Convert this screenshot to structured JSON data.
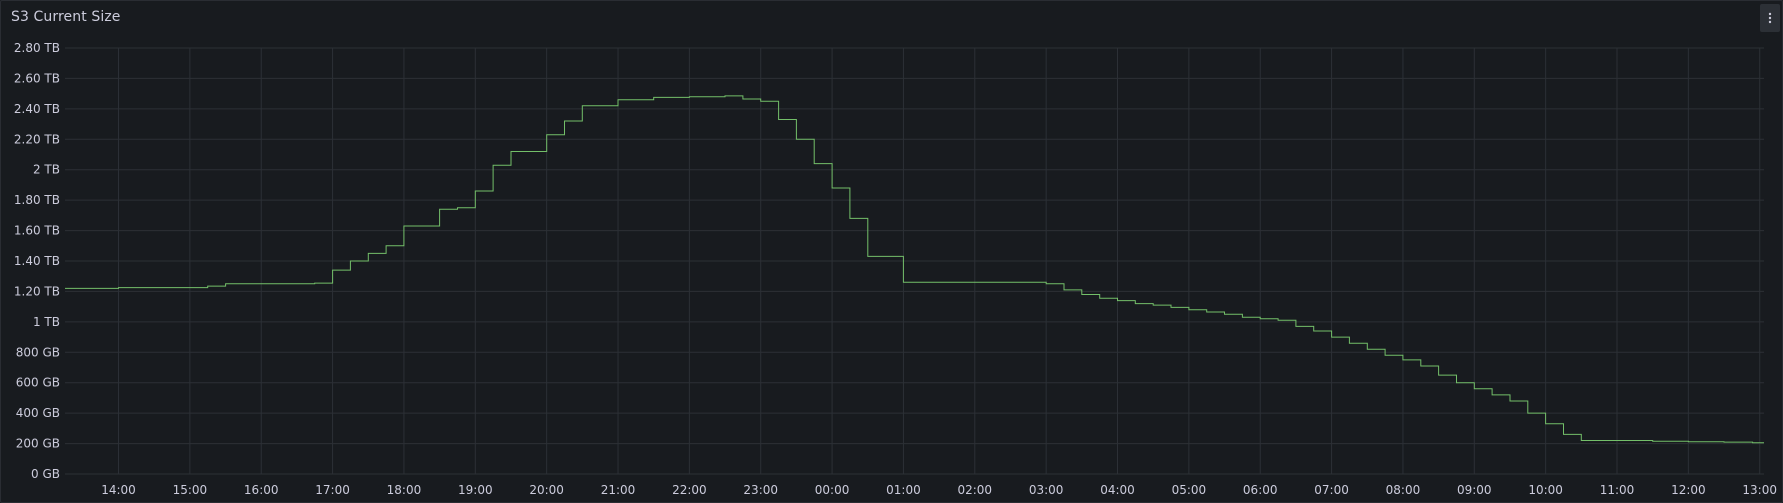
{
  "panel": {
    "title": "S3 Current Size",
    "menu_icon": "kebab-menu-icon"
  },
  "colors": {
    "background": "#181b1f",
    "grid": "#2c3036",
    "series": "#73bf69",
    "text": "#ccccdc"
  },
  "chart_data": {
    "type": "line",
    "interpolation": "step-after",
    "title": "S3 Current Size",
    "xlabel": "",
    "ylabel": "",
    "grid": true,
    "legend": "none",
    "y_unit": "GB",
    "ylim": [
      0,
      2800
    ],
    "yticks": [
      {
        "value": 0,
        "label": "0 GB"
      },
      {
        "value": 200,
        "label": "200 GB"
      },
      {
        "value": 400,
        "label": "400 GB"
      },
      {
        "value": 600,
        "label": "600 GB"
      },
      {
        "value": 800,
        "label": "800 GB"
      },
      {
        "value": 1000,
        "label": "1 TB"
      },
      {
        "value": 1200,
        "label": "1.20 TB"
      },
      {
        "value": 1400,
        "label": "1.40 TB"
      },
      {
        "value": 1600,
        "label": "1.60 TB"
      },
      {
        "value": 1800,
        "label": "1.80 TB"
      },
      {
        "value": 2000,
        "label": "2 TB"
      },
      {
        "value": 2200,
        "label": "2.20 TB"
      },
      {
        "value": 2400,
        "label": "2.40 TB"
      },
      {
        "value": 2600,
        "label": "2.60 TB"
      },
      {
        "value": 2800,
        "label": "2.80 TB"
      }
    ],
    "x_unit": "hours",
    "xlim": [
      13.25,
      37.06
    ],
    "xticks": [
      {
        "value": 14,
        "label": "14:00"
      },
      {
        "value": 15,
        "label": "15:00"
      },
      {
        "value": 16,
        "label": "16:00"
      },
      {
        "value": 17,
        "label": "17:00"
      },
      {
        "value": 18,
        "label": "18:00"
      },
      {
        "value": 19,
        "label": "19:00"
      },
      {
        "value": 20,
        "label": "20:00"
      },
      {
        "value": 21,
        "label": "21:00"
      },
      {
        "value": 22,
        "label": "22:00"
      },
      {
        "value": 23,
        "label": "23:00"
      },
      {
        "value": 24,
        "label": "00:00"
      },
      {
        "value": 25,
        "label": "01:00"
      },
      {
        "value": 26,
        "label": "02:00"
      },
      {
        "value": 27,
        "label": "03:00"
      },
      {
        "value": 28,
        "label": "04:00"
      },
      {
        "value": 29,
        "label": "05:00"
      },
      {
        "value": 30,
        "label": "06:00"
      },
      {
        "value": 31,
        "label": "07:00"
      },
      {
        "value": 32,
        "label": "08:00"
      },
      {
        "value": 33,
        "label": "09:00"
      },
      {
        "value": 34,
        "label": "10:00"
      },
      {
        "value": 35,
        "label": "11:00"
      },
      {
        "value": 36,
        "label": "12:00"
      },
      {
        "value": 37,
        "label": "13:00"
      }
    ],
    "series": [
      {
        "x": [
          13.25,
          14.0,
          15.25,
          15.5,
          16.75,
          17.0,
          17.25,
          17.5,
          17.75,
          18.0,
          18.5,
          18.75,
          19.0,
          19.25,
          19.5,
          20.0,
          20.25,
          20.5,
          21.0,
          21.5,
          22.0,
          22.5,
          22.75,
          23.0,
          23.25,
          23.5,
          23.75,
          24.0,
          24.25,
          24.5,
          25.0,
          26.75,
          27.0,
          27.25,
          27.5,
          27.75,
          28.0,
          28.25,
          28.5,
          28.75,
          29.0,
          29.25,
          29.5,
          29.75,
          30.0,
          30.25,
          30.5,
          30.75,
          31.0,
          31.25,
          31.5,
          31.75,
          32.0,
          32.25,
          32.5,
          32.75,
          33.0,
          33.25,
          33.5,
          33.75,
          34.0,
          34.25,
          34.5,
          35.0,
          35.5,
          36.0,
          36.5,
          36.9,
          37.06
        ],
        "y": [
          1220,
          1225,
          1235,
          1250,
          1255,
          1340,
          1400,
          1450,
          1500,
          1630,
          1740,
          1750,
          1860,
          2030,
          2120,
          2230,
          2320,
          2420,
          2460,
          2475,
          2480,
          2485,
          2465,
          2450,
          2330,
          2200,
          2040,
          1880,
          1680,
          1430,
          1260,
          1260,
          1250,
          1210,
          1180,
          1155,
          1140,
          1120,
          1110,
          1095,
          1080,
          1065,
          1050,
          1030,
          1020,
          1010,
          970,
          940,
          900,
          860,
          820,
          780,
          750,
          710,
          650,
          600,
          560,
          520,
          480,
          400,
          330,
          260,
          220,
          220,
          215,
          212,
          210,
          205,
          205
        ]
      }
    ]
  }
}
